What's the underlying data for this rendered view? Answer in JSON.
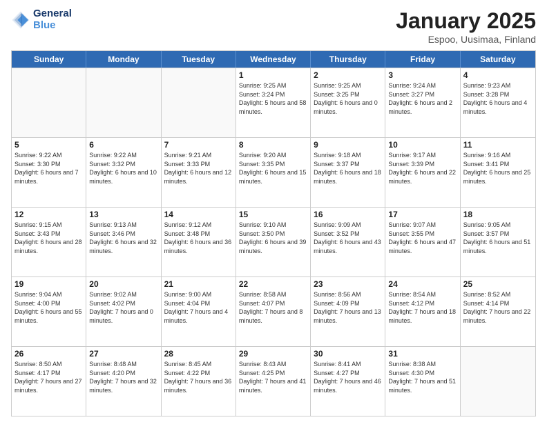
{
  "logo": {
    "line1": "General",
    "line2": "Blue"
  },
  "title": "January 2025",
  "subtitle": "Espoo, Uusimaa, Finland",
  "days_header": [
    "Sunday",
    "Monday",
    "Tuesday",
    "Wednesday",
    "Thursday",
    "Friday",
    "Saturday"
  ],
  "weeks": [
    [
      {
        "day": "",
        "sunrise": "",
        "sunset": "",
        "daylight": ""
      },
      {
        "day": "",
        "sunrise": "",
        "sunset": "",
        "daylight": ""
      },
      {
        "day": "",
        "sunrise": "",
        "sunset": "",
        "daylight": ""
      },
      {
        "day": "1",
        "sunrise": "Sunrise: 9:25 AM",
        "sunset": "Sunset: 3:24 PM",
        "daylight": "Daylight: 5 hours and 58 minutes."
      },
      {
        "day": "2",
        "sunrise": "Sunrise: 9:25 AM",
        "sunset": "Sunset: 3:25 PM",
        "daylight": "Daylight: 6 hours and 0 minutes."
      },
      {
        "day": "3",
        "sunrise": "Sunrise: 9:24 AM",
        "sunset": "Sunset: 3:27 PM",
        "daylight": "Daylight: 6 hours and 2 minutes."
      },
      {
        "day": "4",
        "sunrise": "Sunrise: 9:23 AM",
        "sunset": "Sunset: 3:28 PM",
        "daylight": "Daylight: 6 hours and 4 minutes."
      }
    ],
    [
      {
        "day": "5",
        "sunrise": "Sunrise: 9:22 AM",
        "sunset": "Sunset: 3:30 PM",
        "daylight": "Daylight: 6 hours and 7 minutes."
      },
      {
        "day": "6",
        "sunrise": "Sunrise: 9:22 AM",
        "sunset": "Sunset: 3:32 PM",
        "daylight": "Daylight: 6 hours and 10 minutes."
      },
      {
        "day": "7",
        "sunrise": "Sunrise: 9:21 AM",
        "sunset": "Sunset: 3:33 PM",
        "daylight": "Daylight: 6 hours and 12 minutes."
      },
      {
        "day": "8",
        "sunrise": "Sunrise: 9:20 AM",
        "sunset": "Sunset: 3:35 PM",
        "daylight": "Daylight: 6 hours and 15 minutes."
      },
      {
        "day": "9",
        "sunrise": "Sunrise: 9:18 AM",
        "sunset": "Sunset: 3:37 PM",
        "daylight": "Daylight: 6 hours and 18 minutes."
      },
      {
        "day": "10",
        "sunrise": "Sunrise: 9:17 AM",
        "sunset": "Sunset: 3:39 PM",
        "daylight": "Daylight: 6 hours and 22 minutes."
      },
      {
        "day": "11",
        "sunrise": "Sunrise: 9:16 AM",
        "sunset": "Sunset: 3:41 PM",
        "daylight": "Daylight: 6 hours and 25 minutes."
      }
    ],
    [
      {
        "day": "12",
        "sunrise": "Sunrise: 9:15 AM",
        "sunset": "Sunset: 3:43 PM",
        "daylight": "Daylight: 6 hours and 28 minutes."
      },
      {
        "day": "13",
        "sunrise": "Sunrise: 9:13 AM",
        "sunset": "Sunset: 3:46 PM",
        "daylight": "Daylight: 6 hours and 32 minutes."
      },
      {
        "day": "14",
        "sunrise": "Sunrise: 9:12 AM",
        "sunset": "Sunset: 3:48 PM",
        "daylight": "Daylight: 6 hours and 36 minutes."
      },
      {
        "day": "15",
        "sunrise": "Sunrise: 9:10 AM",
        "sunset": "Sunset: 3:50 PM",
        "daylight": "Daylight: 6 hours and 39 minutes."
      },
      {
        "day": "16",
        "sunrise": "Sunrise: 9:09 AM",
        "sunset": "Sunset: 3:52 PM",
        "daylight": "Daylight: 6 hours and 43 minutes."
      },
      {
        "day": "17",
        "sunrise": "Sunrise: 9:07 AM",
        "sunset": "Sunset: 3:55 PM",
        "daylight": "Daylight: 6 hours and 47 minutes."
      },
      {
        "day": "18",
        "sunrise": "Sunrise: 9:05 AM",
        "sunset": "Sunset: 3:57 PM",
        "daylight": "Daylight: 6 hours and 51 minutes."
      }
    ],
    [
      {
        "day": "19",
        "sunrise": "Sunrise: 9:04 AM",
        "sunset": "Sunset: 4:00 PM",
        "daylight": "Daylight: 6 hours and 55 minutes."
      },
      {
        "day": "20",
        "sunrise": "Sunrise: 9:02 AM",
        "sunset": "Sunset: 4:02 PM",
        "daylight": "Daylight: 7 hours and 0 minutes."
      },
      {
        "day": "21",
        "sunrise": "Sunrise: 9:00 AM",
        "sunset": "Sunset: 4:04 PM",
        "daylight": "Daylight: 7 hours and 4 minutes."
      },
      {
        "day": "22",
        "sunrise": "Sunrise: 8:58 AM",
        "sunset": "Sunset: 4:07 PM",
        "daylight": "Daylight: 7 hours and 8 minutes."
      },
      {
        "day": "23",
        "sunrise": "Sunrise: 8:56 AM",
        "sunset": "Sunset: 4:09 PM",
        "daylight": "Daylight: 7 hours and 13 minutes."
      },
      {
        "day": "24",
        "sunrise": "Sunrise: 8:54 AM",
        "sunset": "Sunset: 4:12 PM",
        "daylight": "Daylight: 7 hours and 18 minutes."
      },
      {
        "day": "25",
        "sunrise": "Sunrise: 8:52 AM",
        "sunset": "Sunset: 4:14 PM",
        "daylight": "Daylight: 7 hours and 22 minutes."
      }
    ],
    [
      {
        "day": "26",
        "sunrise": "Sunrise: 8:50 AM",
        "sunset": "Sunset: 4:17 PM",
        "daylight": "Daylight: 7 hours and 27 minutes."
      },
      {
        "day": "27",
        "sunrise": "Sunrise: 8:48 AM",
        "sunset": "Sunset: 4:20 PM",
        "daylight": "Daylight: 7 hours and 32 minutes."
      },
      {
        "day": "28",
        "sunrise": "Sunrise: 8:45 AM",
        "sunset": "Sunset: 4:22 PM",
        "daylight": "Daylight: 7 hours and 36 minutes."
      },
      {
        "day": "29",
        "sunrise": "Sunrise: 8:43 AM",
        "sunset": "Sunset: 4:25 PM",
        "daylight": "Daylight: 7 hours and 41 minutes."
      },
      {
        "day": "30",
        "sunrise": "Sunrise: 8:41 AM",
        "sunset": "Sunset: 4:27 PM",
        "daylight": "Daylight: 7 hours and 46 minutes."
      },
      {
        "day": "31",
        "sunrise": "Sunrise: 8:38 AM",
        "sunset": "Sunset: 4:30 PM",
        "daylight": "Daylight: 7 hours and 51 minutes."
      },
      {
        "day": "",
        "sunrise": "",
        "sunset": "",
        "daylight": ""
      }
    ]
  ]
}
